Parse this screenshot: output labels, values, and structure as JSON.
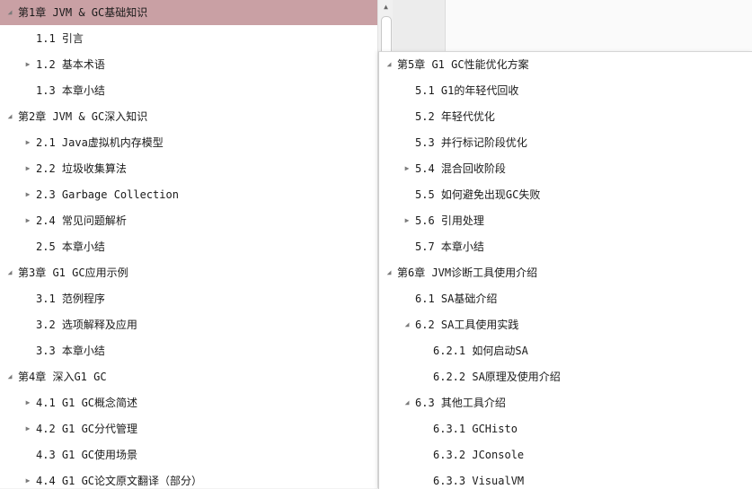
{
  "left_tree": [
    {
      "label": "第1章 JVM & GC基础知识",
      "toggle": "expanded",
      "level": 0,
      "selected": true
    },
    {
      "label": "1.1 引言",
      "toggle": "none",
      "level": 1
    },
    {
      "label": "1.2 基本术语",
      "toggle": "collapsed",
      "level": 1
    },
    {
      "label": "1.3 本章小结",
      "toggle": "none",
      "level": 1
    },
    {
      "label": "第2章 JVM & GC深入知识",
      "toggle": "expanded",
      "level": 0
    },
    {
      "label": "2.1 Java虚拟机内存模型",
      "toggle": "collapsed",
      "level": 1
    },
    {
      "label": "2.2 垃圾收集算法",
      "toggle": "collapsed",
      "level": 1
    },
    {
      "label": "2.3 Garbage Collection",
      "toggle": "collapsed",
      "level": 1
    },
    {
      "label": "2.4 常见问题解析",
      "toggle": "collapsed",
      "level": 1
    },
    {
      "label": "2.5 本章小结",
      "toggle": "none",
      "level": 1
    },
    {
      "label": "第3章 G1 GC应用示例",
      "toggle": "expanded",
      "level": 0
    },
    {
      "label": "3.1 范例程序",
      "toggle": "none",
      "level": 1
    },
    {
      "label": "3.2 选项解释及应用",
      "toggle": "none",
      "level": 1
    },
    {
      "label": "3.3 本章小结",
      "toggle": "none",
      "level": 1
    },
    {
      "label": "第4章 深入G1 GC",
      "toggle": "expanded",
      "level": 0
    },
    {
      "label": "4.1 G1 GC概念简述",
      "toggle": "collapsed",
      "level": 1
    },
    {
      "label": "4.2 G1 GC分代管理",
      "toggle": "collapsed",
      "level": 1
    },
    {
      "label": "4.3 G1 GC使用场景",
      "toggle": "none",
      "level": 1
    },
    {
      "label": "4.4 G1 GC论文原文翻译（部分）",
      "toggle": "collapsed",
      "level": 1
    }
  ],
  "right_tree": [
    {
      "label": "第5章 G1 GC性能优化方案",
      "toggle": "expanded",
      "level": 0
    },
    {
      "label": "5.1 G1的年轻代回收",
      "toggle": "none",
      "level": 1
    },
    {
      "label": "5.2 年轻代优化",
      "toggle": "none",
      "level": 1
    },
    {
      "label": "5.3 并行标记阶段优化",
      "toggle": "none",
      "level": 1
    },
    {
      "label": "5.4 混合回收阶段",
      "toggle": "collapsed",
      "level": 1
    },
    {
      "label": "5.5 如何避免出现GC失败",
      "toggle": "none",
      "level": 1
    },
    {
      "label": "5.6 引用处理",
      "toggle": "collapsed",
      "level": 1
    },
    {
      "label": "5.7 本章小结",
      "toggle": "none",
      "level": 1
    },
    {
      "label": "第6章 JVM诊断工具使用介绍",
      "toggle": "expanded",
      "level": 0
    },
    {
      "label": "6.1 SA基础介绍",
      "toggle": "none",
      "level": 1
    },
    {
      "label": "6.2 SA工具使用实践",
      "toggle": "expanded",
      "level": 1
    },
    {
      "label": "6.2.1 如何启动SA",
      "toggle": "none",
      "level": 2
    },
    {
      "label": "6.2.2 SA原理及使用介绍",
      "toggle": "none",
      "level": 2
    },
    {
      "label": "6.3 其他工具介绍",
      "toggle": "expanded",
      "level": 1
    },
    {
      "label": "6.3.1 GCHisto",
      "toggle": "none",
      "level": 2
    },
    {
      "label": "6.3.2 JConsole",
      "toggle": "none",
      "level": 2
    },
    {
      "label": "6.3.3 VisualVM",
      "toggle": "none",
      "level": 2
    }
  ],
  "icons": {
    "expanded": "◢",
    "collapsed": "▶",
    "scroll_up": "▲"
  },
  "colors": {
    "selected_row": "#c9a0a4",
    "scrollbar": "#f0f0f0"
  }
}
